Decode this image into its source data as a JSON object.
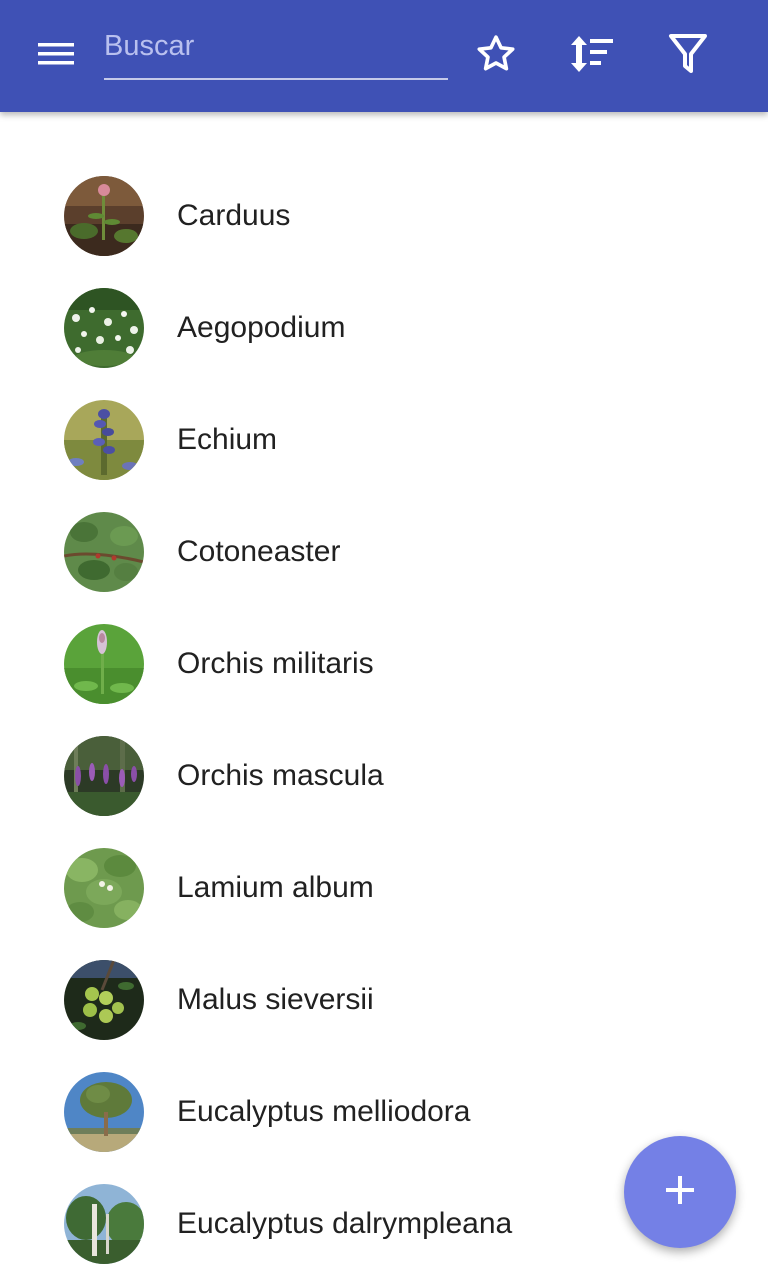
{
  "appbar": {
    "background_color": "#3f51b5",
    "menu_icon": "menu-icon",
    "search": {
      "value": "",
      "placeholder": "Buscar"
    },
    "actions": [
      {
        "icon": "star-outline-icon"
      },
      {
        "icon": "sort-icon"
      },
      {
        "icon": "filter-icon"
      }
    ]
  },
  "plants": [
    {
      "name": "Carduus"
    },
    {
      "name": "Aegopodium"
    },
    {
      "name": "Echium"
    },
    {
      "name": "Cotoneaster"
    },
    {
      "name": "Orchis militaris"
    },
    {
      "name": "Orchis mascula"
    },
    {
      "name": "Lamium album"
    },
    {
      "name": "Malus sieversii"
    },
    {
      "name": "Eucalyptus melliodora"
    },
    {
      "name": "Eucalyptus dalrympleana"
    }
  ],
  "fab": {
    "icon": "plus-icon",
    "color": "#7480e6"
  }
}
